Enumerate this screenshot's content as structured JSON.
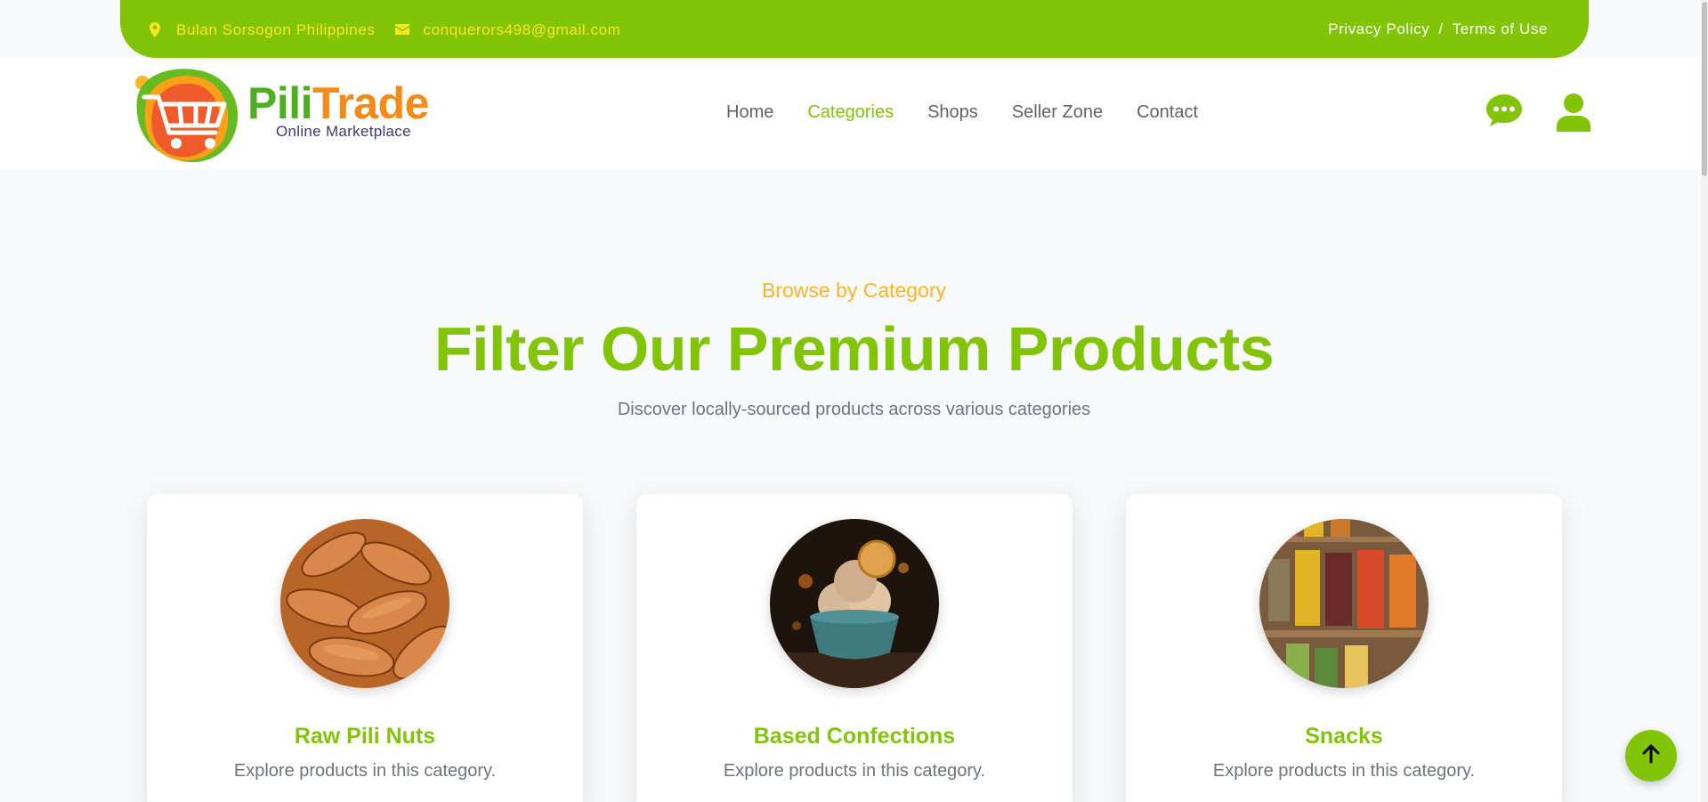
{
  "topbar": {
    "location": "Bulan Sorsogon Philippines",
    "email": "conquerors498@gmail.com",
    "privacy": "Privacy Policy",
    "separator": "/",
    "terms": "Terms of Use",
    "bg_color": "#81c408",
    "text_color": "#ffe51f"
  },
  "brand": {
    "name_part1": "Pili",
    "name_part2": "Trade",
    "tagline": "Online Marketplace",
    "logo_icon": "shopping-cart-icon"
  },
  "nav": {
    "items": [
      {
        "label": "Home",
        "active": false
      },
      {
        "label": "Categories",
        "active": true
      },
      {
        "label": "Shops",
        "active": false
      },
      {
        "label": "Seller Zone",
        "active": false
      },
      {
        "label": "Contact",
        "active": false
      }
    ],
    "chat_icon": "chat-icon",
    "user_icon": "user-icon"
  },
  "hero": {
    "eyebrow": "Browse by Category",
    "headline": "Filter Our Premium Products",
    "subline": "Discover locally-sourced products across various categories"
  },
  "categories": [
    {
      "title": "Raw Pili Nuts",
      "desc": "Explore products in this category.",
      "image": "pili-nuts-image"
    },
    {
      "title": "Based Confections",
      "desc": "Explore products in this category.",
      "image": "ice-cream-bowl-image"
    },
    {
      "title": "Snacks",
      "desc": "Explore products in this category.",
      "image": "snack-packs-shelf-image"
    }
  ],
  "colors": {
    "accent": "#81c408",
    "secondary": "#ffb524",
    "muted": "#6c757d"
  }
}
